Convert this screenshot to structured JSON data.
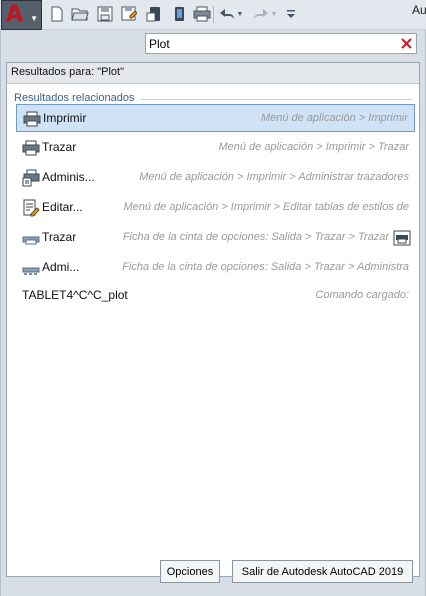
{
  "title_fragment": "Au",
  "search": {
    "value": "Plot"
  },
  "results": {
    "header": "Resultados para: \"Plot\"",
    "section": "Resultados relacionados",
    "items": [
      {
        "name": "Imprimir",
        "path": "Menú de aplicación > Imprimir",
        "icon": "printer-icon",
        "selected": true
      },
      {
        "name": "Trazar",
        "path": "Menú de aplicación > Imprimir > Trazar",
        "icon": "printer-icon"
      },
      {
        "name": "Adminis...",
        "path": "Menú de aplicación > Imprimir > Administrar trazadores",
        "icon": "plotter-manager-icon"
      },
      {
        "name": "Editar...",
        "path": "Menú de aplicación > Imprimir > Editar tablas de estilos de",
        "icon": "edit-plot-style-icon"
      },
      {
        "name": "Trazar",
        "path": "Ficha de la cinta de opciones: Salida > Trazar > Trazar",
        "icon": "ribbon-plot-icon",
        "trailing_icon": "plot-ribbon-button-icon"
      },
      {
        "name": "Admi...",
        "path": "Ficha de la cinta de opciones: Salida > Trazar > Administra",
        "icon": "ribbon-plotter-manager-icon"
      },
      {
        "name": "TABLET4^C^C_plot",
        "path": "Comando cargado:",
        "icon": ""
      }
    ]
  },
  "buttons": {
    "options": "Opciones",
    "exit": "Salir de Autodesk AutoCAD 2019"
  },
  "colors": {
    "accent_selected": "#cfe2f6",
    "section_title": "#3b5f93",
    "logo_red": "#c8101e"
  }
}
